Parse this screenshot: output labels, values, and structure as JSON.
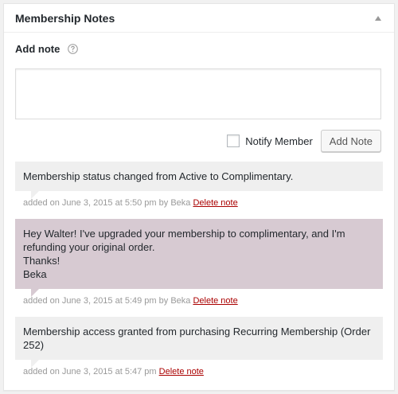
{
  "panel": {
    "title": "Membership Notes"
  },
  "add_note": {
    "label": "Add note",
    "textarea_value": "",
    "textarea_placeholder": ""
  },
  "actions": {
    "notify_label": "Notify Member",
    "notify_checked": false,
    "add_button": "Add Note"
  },
  "notes": [
    {
      "type": "system",
      "text_lines": [
        "Membership status changed from Active to Complimentary."
      ],
      "meta_prefix": "added on June 3, 2015 at 5:50 pm",
      "meta_author": "by Beka",
      "delete_label": "Delete note"
    },
    {
      "type": "customer",
      "text_lines": [
        "Hey Walter! I've upgraded your membership to complimentary, and I'm refunding your original order.",
        "Thanks!",
        "Beka"
      ],
      "meta_prefix": "added on June 3, 2015 at 5:49 pm",
      "meta_author": "by Beka",
      "delete_label": "Delete note"
    },
    {
      "type": "system",
      "text_lines": [
        "Membership access granted from purchasing Recurring Membership (Order 252)"
      ],
      "meta_prefix": "added on June 3, 2015 at 5:47 pm",
      "meta_author": "",
      "delete_label": "Delete note"
    }
  ],
  "colors": {
    "customer_note_bg": "#d7cad2",
    "system_note_bg": "#efefef",
    "delete_link": "#aa0000"
  },
  "icons": {
    "collapse": "triangle-up-icon",
    "help": "help-icon"
  }
}
